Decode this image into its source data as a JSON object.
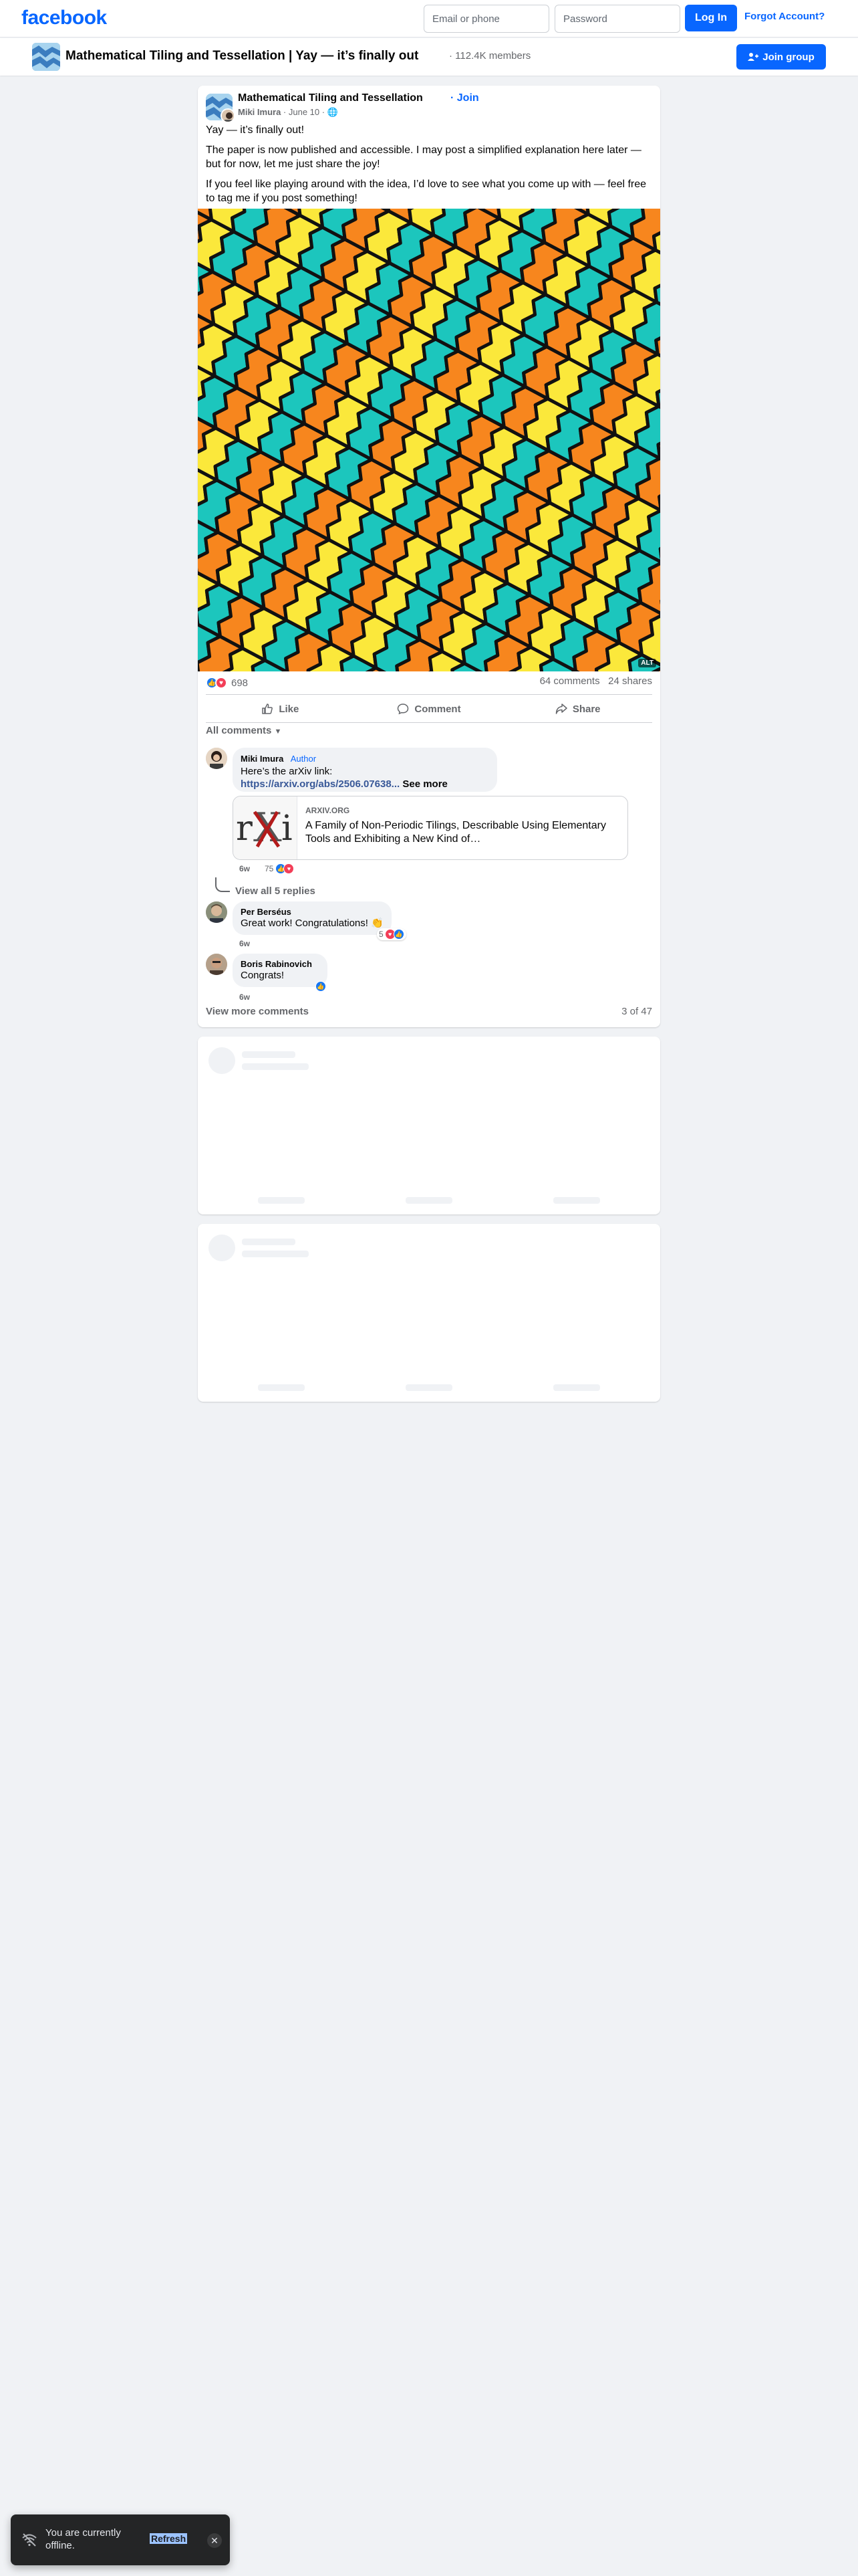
{
  "nav": {
    "logo": "facebook",
    "email_placeholder": "Email or phone",
    "password_placeholder": "Password",
    "login_label": "Log In",
    "forgot_label": "Forgot Account?"
  },
  "group_bar": {
    "title": "Mathematical Tiling and Tessellation | Yay — it’s finally out",
    "members": "· 112.4K members",
    "join_label": "Join group"
  },
  "post": {
    "group_name": "Mathematical Tiling and Tessellation",
    "join_label": "· Join",
    "author": "Miki Imura",
    "date": "· June 10 ·",
    "paragraphs": [
      "Yay — it’s finally out!",
      "The paper is now published and accessible. I may post a simplified explanation here later — but for now, let me just share the joy!",
      "If you feel like playing around with the idea, I’d love to see what you come up with — feel free to tag me if you post something!"
    ],
    "image_alt_badge": "ALT",
    "reaction_count": "698",
    "comments_count": "64 comments",
    "shares_count": "24 shares",
    "actions": {
      "like": "Like",
      "comment": "Comment",
      "share": "Share"
    },
    "all_comments_label": "All comments",
    "colors": {
      "orange": "#f7861e",
      "teal": "#1cc6bd",
      "yellow": "#fbe83b",
      "outline": "#111111"
    }
  },
  "comments": [
    {
      "name": "Miki Imura",
      "badge": "Author",
      "text": "Here’s the arXiv link:",
      "link": "https://arxiv.org/abs/2506.07638...",
      "see_more": "See more",
      "time": "6w",
      "reactions": "75",
      "preview": {
        "domain": "ARXIV.ORG",
        "title": "A Family of Non-Periodic Tilings, Describable Using Elementary Tools and Exhibiting a New Kind of…"
      },
      "view_replies": "View all 5 replies"
    },
    {
      "name": "Per Berséus",
      "text": "Great work! Congratulations! 👏",
      "time": "6w",
      "reactions": "5"
    },
    {
      "name": "Boris Rabinovich",
      "text": "Congrats!",
      "time": "6w"
    }
  ],
  "footer": {
    "view_more": "View more comments",
    "page_count": "3 of 47"
  },
  "toast": {
    "text": "You are currently offline.",
    "refresh": "Refresh",
    "close_icon": "close-icon"
  }
}
